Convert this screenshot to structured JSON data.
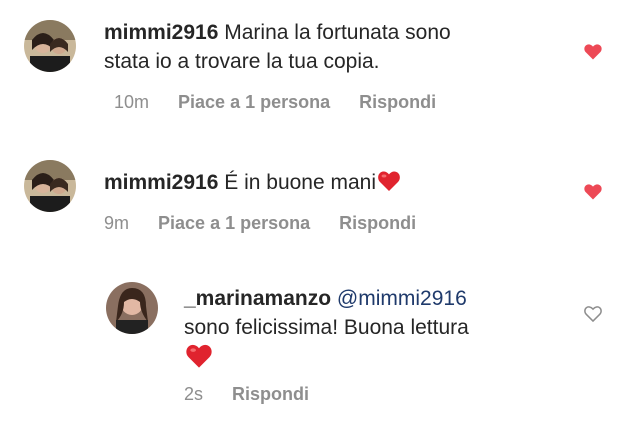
{
  "comments": [
    {
      "username": "mimmi2916",
      "text_line1": "Marina la fortunata sono",
      "text_line2": "stata io a trovare la tua copia.",
      "time": "10m",
      "likes": "Piace a 1 persona",
      "reply": "Rispondi",
      "liked": true
    },
    {
      "username": "mimmi2916",
      "text": "É in buone mani",
      "time": "9m",
      "likes": "Piace a 1 persona",
      "reply": "Rispondi",
      "liked": true
    },
    {
      "username": "_marinamanzo",
      "mention": "@mimmi2916",
      "text_line2": "sono felicissima! Buona lettura",
      "time": "2s",
      "reply": "Rispondi",
      "liked": false
    }
  ],
  "colors": {
    "text": "#262626",
    "meta": "#8e8e8e",
    "mention": "#1f3a6b",
    "like_red": "#ed4956",
    "heart_outline": "#8e8e8e"
  },
  "icons": {
    "liked": "heart-filled-icon",
    "unliked": "heart-outline-icon",
    "emoji": "red-heart-emoji"
  }
}
